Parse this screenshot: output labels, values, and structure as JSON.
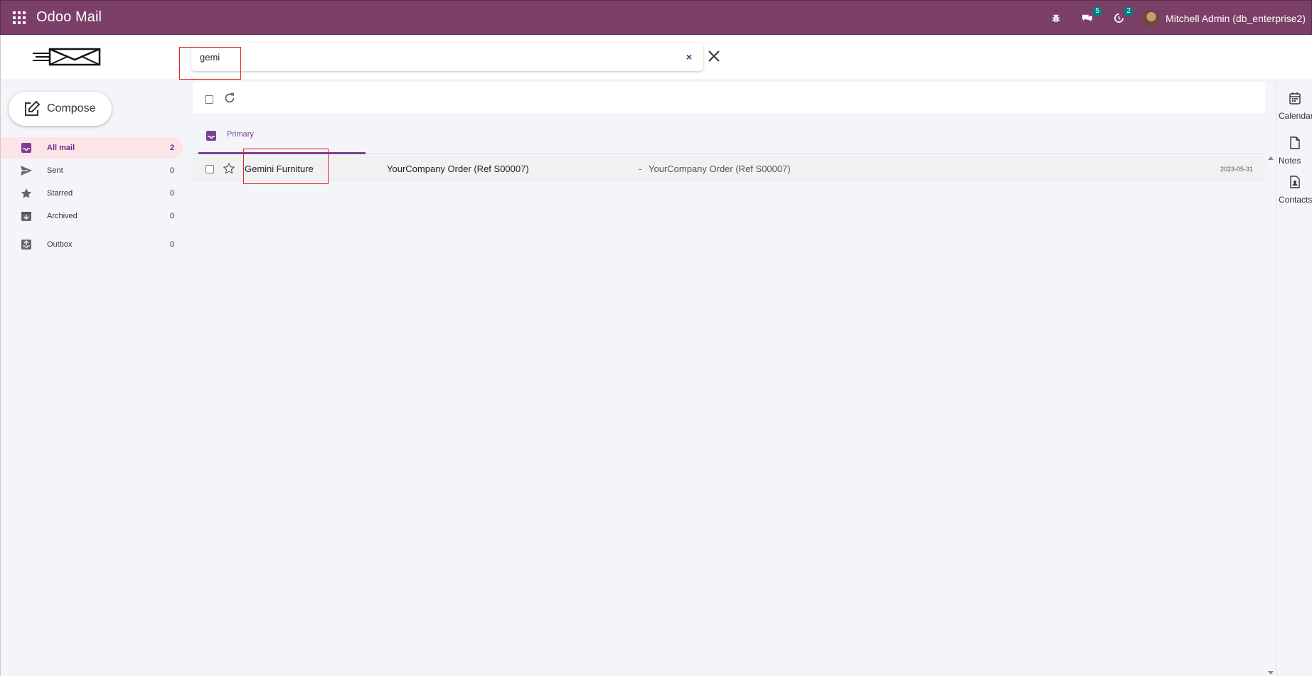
{
  "navbar": {
    "app_title": "Odoo Mail",
    "chat_badge": "5",
    "activity_badge": "2",
    "user_label": "Mitchell Admin (db_enterprise2)"
  },
  "search": {
    "value": "gemi",
    "clear_symbol": "×"
  },
  "compose": {
    "label": "Compose"
  },
  "sidebar": {
    "items": [
      {
        "label": "All mail",
        "count": "2",
        "icon": "inbox-icon"
      },
      {
        "label": "Sent",
        "count": "0",
        "icon": "send-icon"
      },
      {
        "label": "Starred",
        "count": "0",
        "icon": "star-icon"
      },
      {
        "label": "Archived",
        "count": "0",
        "icon": "archive-icon"
      },
      {
        "label": "Outbox",
        "count": "0",
        "icon": "outbox-icon"
      }
    ]
  },
  "tabs": {
    "primary": "Primary"
  },
  "messages": [
    {
      "sender": "Gemini Furniture",
      "subject": "YourCompany Order (Ref S00007)",
      "separator": "-",
      "preview": "YourCompany Order (Ref S00007)",
      "date": "2023-05-31"
    }
  ],
  "right_panel": {
    "items": [
      {
        "label": "Calendar",
        "icon": "calendar-icon"
      },
      {
        "label": "Notes",
        "icon": "note-icon"
      },
      {
        "label": "Contacts",
        "icon": "contact-icon"
      }
    ]
  },
  "colors": {
    "navbar": "#7c3f68",
    "accent": "#7c3f98",
    "badge": "#017e84",
    "highlight": "#e0201b"
  }
}
